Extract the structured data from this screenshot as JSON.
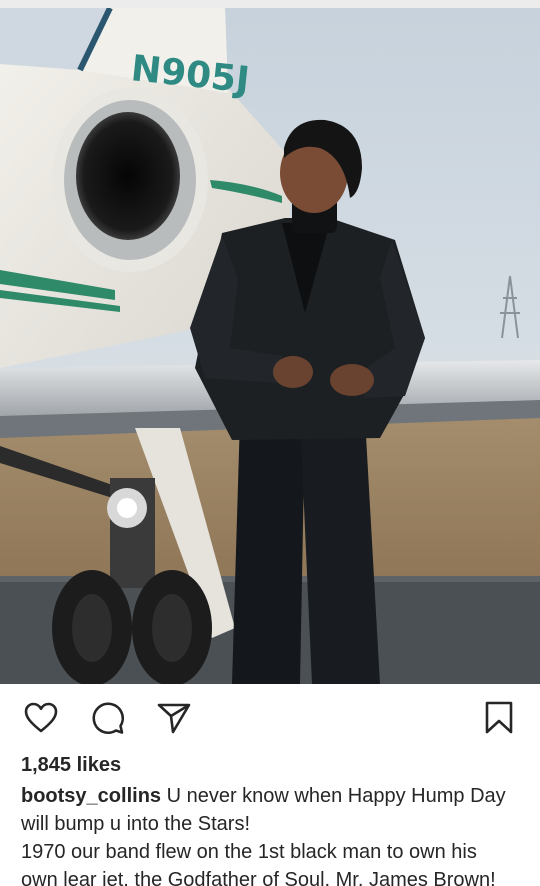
{
  "post": {
    "likes_text": "1,845 likes",
    "username": "bootsy_collins",
    "caption_lines": [
      "U never know when Happy Hump Day",
      "will bump u into the Stars!",
      "1970 our band flew on the 1st black man to own his",
      "own lear jet, the Godfather of Soul, Mr. James Brown!"
    ],
    "jet_registration": "N905J"
  },
  "actions": {
    "like_icon": "heart-icon",
    "comment_icon": "comment-icon",
    "share_icon": "send-icon",
    "save_icon": "bookmark-icon"
  },
  "colors": {
    "text": "#262626",
    "jet_stripe": "#2f8a6a"
  }
}
